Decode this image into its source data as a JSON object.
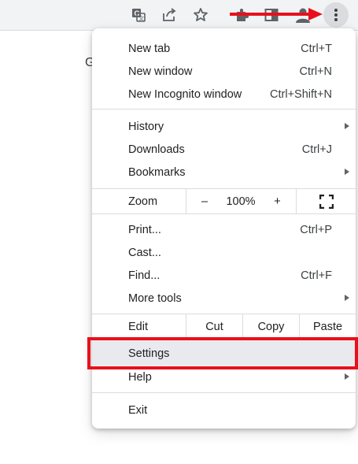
{
  "menu": {
    "group1": [
      {
        "label": "New tab",
        "shortcut": "Ctrl+T"
      },
      {
        "label": "New window",
        "shortcut": "Ctrl+N"
      },
      {
        "label": "New Incognito window",
        "shortcut": "Ctrl+Shift+N"
      }
    ],
    "group2": [
      {
        "label": "History",
        "shortcut": ""
      },
      {
        "label": "Downloads",
        "shortcut": "Ctrl+J"
      },
      {
        "label": "Bookmarks",
        "shortcut": ""
      }
    ],
    "zoom": {
      "label": "Zoom",
      "minus": "–",
      "value": "100%",
      "plus": "+"
    },
    "group3": [
      {
        "label": "Print...",
        "shortcut": "Ctrl+P"
      },
      {
        "label": "Cast...",
        "shortcut": ""
      },
      {
        "label": "Find...",
        "shortcut": "Ctrl+F"
      },
      {
        "label": "More tools",
        "shortcut": ""
      }
    ],
    "edit": {
      "label": "Edit",
      "cut": "Cut",
      "copy": "Copy",
      "paste": "Paste"
    },
    "group4": [
      {
        "label": "Settings"
      },
      {
        "label": "Help"
      }
    ],
    "exit": {
      "label": "Exit"
    }
  },
  "page": {
    "partial_letter": "G"
  },
  "colors": {
    "annotation_red": "#e8101c",
    "toolbar_bg": "#f1f3f4"
  },
  "icons": [
    "translate-icon",
    "share-icon",
    "star-icon",
    "extensions-icon",
    "side-panel-icon",
    "profile-icon",
    "more-vert-icon",
    "fullscreen-icon"
  ]
}
